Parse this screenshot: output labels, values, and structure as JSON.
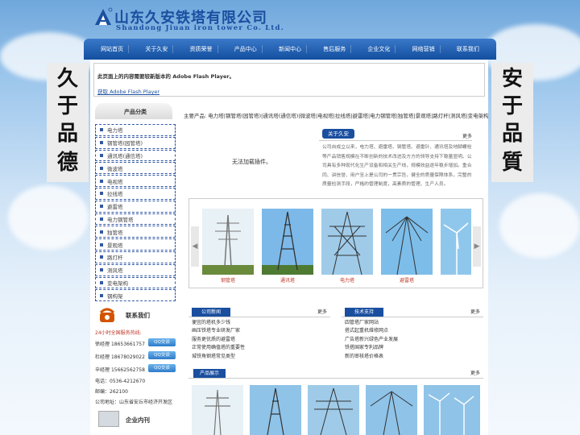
{
  "header": {
    "logo_cn": "山东久安铁塔有限公司",
    "logo_en": "Shandong Jiuan iron tower Co. Ltd."
  },
  "nav": [
    "网站首页",
    "关于久安",
    "资质荣誉",
    "产品中心",
    "新闻中心",
    "售后服务",
    "企业文化",
    "网络营销",
    "联系我们"
  ],
  "side": {
    "left": [
      "久",
      "于",
      "品",
      "德"
    ],
    "right": [
      "安",
      "于",
      "品",
      "質"
    ]
  },
  "flash": {
    "msg": "此页面上的内容需要较新版本的 Adobe Flash Player。",
    "link": "获取 Adobe Flash Player"
  },
  "categories": {
    "title": "产品分类",
    "items": [
      "电力塔",
      "钢管塔(园管塔)",
      "通讯塔(通信塔)",
      "微波塔",
      "电视塔",
      "拉线塔",
      "避雷塔",
      "电力钢管塔",
      "独管塔",
      "景观塔",
      "路灯杆",
      "测风塔",
      "变电架构",
      "钢构架"
    ]
  },
  "crumb": "主要产品: 电力塔|钢管塔(园管塔)|通讯塔(通信塔)|微波塔|电视塔|拉线塔|避雷塔|电力钢管塔|独管塔|景观塔|路灯杆|测风塔|变电架构|钢构架",
  "plugin": "无法加载插件。",
  "about": {
    "tag": "关于久安",
    "more": "更多",
    "text": "公司自成立以来，电力塔、避雷塔、钢管塔、避雷针、通讯塔及地脚螺栓等产品销售规模在不断创新的技术改进及方方的领导支持下稳量显明。公司具有多种现代化生产设备和相关生产线，规模效益逐年稳步增加。重合同、讲信誉、用户至上是公司的一贯宗旨，健全的质量保障体系，完整的质量检测手段，严格的管理制度，高素质的管理、生产人员。"
  },
  "gallery": [
    {
      "caption": "钢管塔"
    },
    {
      "caption": "通讯塔"
    },
    {
      "caption": "电力塔"
    },
    {
      "caption": "避雷塔"
    }
  ],
  "contact": {
    "title": "联系我们",
    "hotline": "24小时全国服务热线:",
    "rows": [
      {
        "name": "徐经理",
        "phone": "18653661757",
        "qq": "QQ交谈"
      },
      {
        "name": "杜经理",
        "phone": "18678029022",
        "qq": "QQ交谈"
      },
      {
        "name": "辛经理",
        "phone": "15662562758",
        "qq": "QQ交谈"
      }
    ],
    "tel": "电话：0536-4212670",
    "post": "邮编：262100",
    "addr": "公司地址：山东省安丘市经济开发区"
  },
  "enterprise": {
    "title": "企业内刊"
  },
  "company_news": {
    "tag": "公司新闻",
    "more": "更多",
    "items": [
      "便宜的塔机多少钱",
      "画压铁塔专业研发厂家",
      "服务更优质的避雷塔",
      "正常使用确值塔的重要性",
      "城铁角钢塔常见类型"
    ]
  },
  "tech_support": {
    "tag": "技术支持",
    "more": "更多",
    "items": [
      "四管塔厂家网站",
      "搭式起重机维修网点",
      "广告塔新兴绿色产业发展",
      "铁搭国家专利品牌",
      "新的审核塔价格表"
    ]
  },
  "showcase": {
    "tag": "产品展示",
    "more": "更多"
  }
}
